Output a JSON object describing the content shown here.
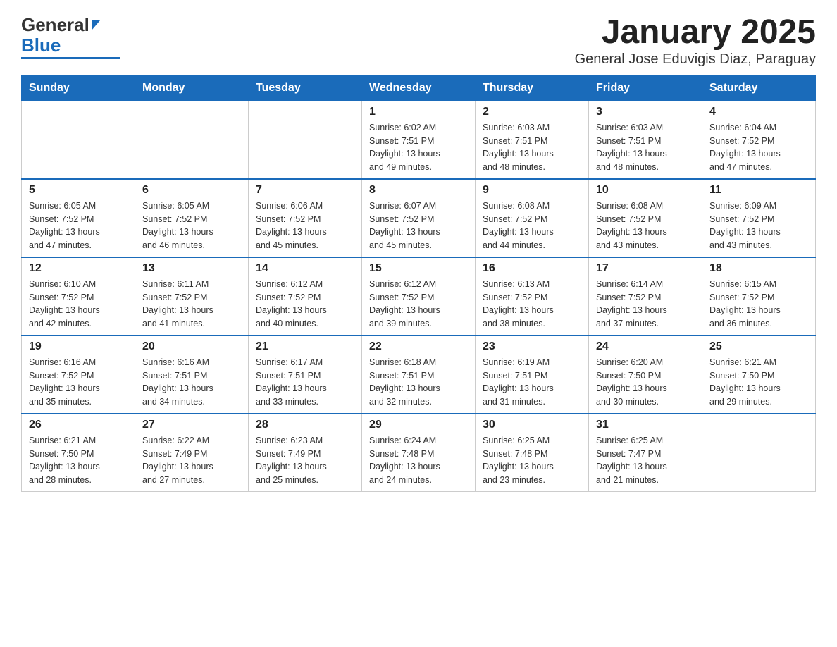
{
  "header": {
    "logo_general": "General",
    "logo_blue": "Blue",
    "title": "January 2025",
    "subtitle": "General Jose Eduvigis Diaz, Paraguay"
  },
  "calendar": {
    "days_of_week": [
      "Sunday",
      "Monday",
      "Tuesday",
      "Wednesday",
      "Thursday",
      "Friday",
      "Saturday"
    ],
    "weeks": [
      [
        {
          "day": "",
          "info": ""
        },
        {
          "day": "",
          "info": ""
        },
        {
          "day": "",
          "info": ""
        },
        {
          "day": "1",
          "info": "Sunrise: 6:02 AM\nSunset: 7:51 PM\nDaylight: 13 hours\nand 49 minutes."
        },
        {
          "day": "2",
          "info": "Sunrise: 6:03 AM\nSunset: 7:51 PM\nDaylight: 13 hours\nand 48 minutes."
        },
        {
          "day": "3",
          "info": "Sunrise: 6:03 AM\nSunset: 7:51 PM\nDaylight: 13 hours\nand 48 minutes."
        },
        {
          "day": "4",
          "info": "Sunrise: 6:04 AM\nSunset: 7:52 PM\nDaylight: 13 hours\nand 47 minutes."
        }
      ],
      [
        {
          "day": "5",
          "info": "Sunrise: 6:05 AM\nSunset: 7:52 PM\nDaylight: 13 hours\nand 47 minutes."
        },
        {
          "day": "6",
          "info": "Sunrise: 6:05 AM\nSunset: 7:52 PM\nDaylight: 13 hours\nand 46 minutes."
        },
        {
          "day": "7",
          "info": "Sunrise: 6:06 AM\nSunset: 7:52 PM\nDaylight: 13 hours\nand 45 minutes."
        },
        {
          "day": "8",
          "info": "Sunrise: 6:07 AM\nSunset: 7:52 PM\nDaylight: 13 hours\nand 45 minutes."
        },
        {
          "day": "9",
          "info": "Sunrise: 6:08 AM\nSunset: 7:52 PM\nDaylight: 13 hours\nand 44 minutes."
        },
        {
          "day": "10",
          "info": "Sunrise: 6:08 AM\nSunset: 7:52 PM\nDaylight: 13 hours\nand 43 minutes."
        },
        {
          "day": "11",
          "info": "Sunrise: 6:09 AM\nSunset: 7:52 PM\nDaylight: 13 hours\nand 43 minutes."
        }
      ],
      [
        {
          "day": "12",
          "info": "Sunrise: 6:10 AM\nSunset: 7:52 PM\nDaylight: 13 hours\nand 42 minutes."
        },
        {
          "day": "13",
          "info": "Sunrise: 6:11 AM\nSunset: 7:52 PM\nDaylight: 13 hours\nand 41 minutes."
        },
        {
          "day": "14",
          "info": "Sunrise: 6:12 AM\nSunset: 7:52 PM\nDaylight: 13 hours\nand 40 minutes."
        },
        {
          "day": "15",
          "info": "Sunrise: 6:12 AM\nSunset: 7:52 PM\nDaylight: 13 hours\nand 39 minutes."
        },
        {
          "day": "16",
          "info": "Sunrise: 6:13 AM\nSunset: 7:52 PM\nDaylight: 13 hours\nand 38 minutes."
        },
        {
          "day": "17",
          "info": "Sunrise: 6:14 AM\nSunset: 7:52 PM\nDaylight: 13 hours\nand 37 minutes."
        },
        {
          "day": "18",
          "info": "Sunrise: 6:15 AM\nSunset: 7:52 PM\nDaylight: 13 hours\nand 36 minutes."
        }
      ],
      [
        {
          "day": "19",
          "info": "Sunrise: 6:16 AM\nSunset: 7:52 PM\nDaylight: 13 hours\nand 35 minutes."
        },
        {
          "day": "20",
          "info": "Sunrise: 6:16 AM\nSunset: 7:51 PM\nDaylight: 13 hours\nand 34 minutes."
        },
        {
          "day": "21",
          "info": "Sunrise: 6:17 AM\nSunset: 7:51 PM\nDaylight: 13 hours\nand 33 minutes."
        },
        {
          "day": "22",
          "info": "Sunrise: 6:18 AM\nSunset: 7:51 PM\nDaylight: 13 hours\nand 32 minutes."
        },
        {
          "day": "23",
          "info": "Sunrise: 6:19 AM\nSunset: 7:51 PM\nDaylight: 13 hours\nand 31 minutes."
        },
        {
          "day": "24",
          "info": "Sunrise: 6:20 AM\nSunset: 7:50 PM\nDaylight: 13 hours\nand 30 minutes."
        },
        {
          "day": "25",
          "info": "Sunrise: 6:21 AM\nSunset: 7:50 PM\nDaylight: 13 hours\nand 29 minutes."
        }
      ],
      [
        {
          "day": "26",
          "info": "Sunrise: 6:21 AM\nSunset: 7:50 PM\nDaylight: 13 hours\nand 28 minutes."
        },
        {
          "day": "27",
          "info": "Sunrise: 6:22 AM\nSunset: 7:49 PM\nDaylight: 13 hours\nand 27 minutes."
        },
        {
          "day": "28",
          "info": "Sunrise: 6:23 AM\nSunset: 7:49 PM\nDaylight: 13 hours\nand 25 minutes."
        },
        {
          "day": "29",
          "info": "Sunrise: 6:24 AM\nSunset: 7:48 PM\nDaylight: 13 hours\nand 24 minutes."
        },
        {
          "day": "30",
          "info": "Sunrise: 6:25 AM\nSunset: 7:48 PM\nDaylight: 13 hours\nand 23 minutes."
        },
        {
          "day": "31",
          "info": "Sunrise: 6:25 AM\nSunset: 7:47 PM\nDaylight: 13 hours\nand 21 minutes."
        },
        {
          "day": "",
          "info": ""
        }
      ]
    ]
  }
}
